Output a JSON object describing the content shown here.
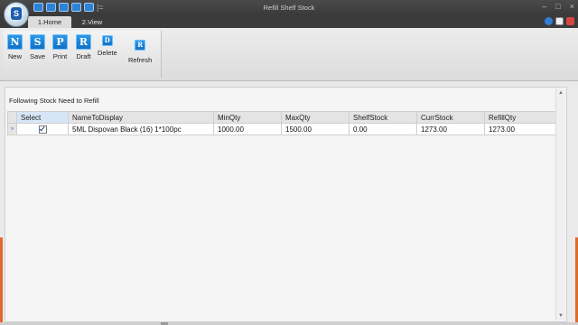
{
  "window": {
    "title": "Refill Shelf Stock",
    "controls": [
      "–",
      "□",
      "×"
    ]
  },
  "app_orb": {
    "icon": "app-logo-icon",
    "glyph": "S"
  },
  "quick_access": {
    "icons": [
      "qat-icon-1",
      "qat-icon-2",
      "qat-icon-3",
      "qat-icon-4",
      "qat-icon-5"
    ],
    "separator": "|="
  },
  "tabs": [
    {
      "label": "1.Home",
      "active": true
    },
    {
      "label": "2.View",
      "active": false
    }
  ],
  "ribbon": {
    "buttons": [
      {
        "label": "New",
        "glyph": "N",
        "icon": "new-icon"
      },
      {
        "label": "Save",
        "glyph": "S",
        "icon": "save-icon"
      },
      {
        "label": "Print",
        "glyph": "P",
        "icon": "print-icon"
      },
      {
        "label": "Draft",
        "glyph": "R",
        "icon": "draft-icon"
      },
      {
        "label": "Delete",
        "glyph": "D",
        "icon": "delete-icon"
      },
      {
        "label": "Refresh",
        "glyph": "R",
        "icon": "refresh-icon"
      }
    ]
  },
  "panel": {
    "title": "Following Stock Need to Refill",
    "columns": [
      "Select",
      "NameToDisplay",
      "MinQty",
      "MaxQty",
      "ShelfStock",
      "CurrStock",
      "RefillQty"
    ],
    "rows": [
      {
        "marker": "»",
        "select": true,
        "name": "5ML Dispovan Black (16) 1*100pc",
        "min": "1000.00",
        "max": "1500.00",
        "shelf": "0.00",
        "curr": "1273.00",
        "refill": "1273.00"
      }
    ]
  },
  "colors": {
    "accent": "#1b7fd6",
    "titlebar": "#3a3a3a",
    "orange_edge": "#e06a2a"
  }
}
